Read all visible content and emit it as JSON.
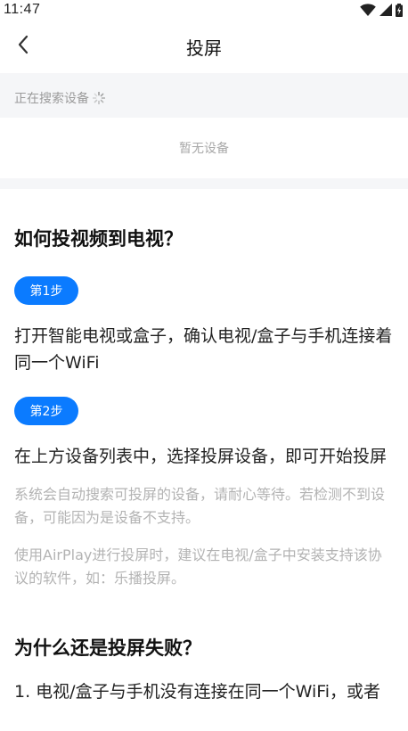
{
  "status_bar": {
    "time": "11:47",
    "icons": [
      "wifi-icon",
      "cell-signal-icon",
      "battery-charging-icon"
    ]
  },
  "header": {
    "title": "投屏",
    "back_icon": "chevron-left-icon"
  },
  "device_search": {
    "status_text": "正在搜索设备",
    "spinner_icon": "loading-spinner-icon",
    "empty_text": "暂无设备"
  },
  "help": {
    "title": "如何投视频到电视？",
    "steps": [
      {
        "badge": "第1步",
        "text": "打开智能电视或盒子，确认电视/盒子与手机连接着同一个WiFi"
      },
      {
        "badge": "第2步",
        "text": "在上方设备列表中，选择投屏设备，即可开始投屏"
      }
    ],
    "notes": [
      "系统会自动搜索可投屏的设备，请耐心等待。若检测不到设备，可能因为是设备不支持。",
      "使用AirPlay进行投屏时，建议在电视/盒子中安装支持该协议的软件，如：乐播投屏。"
    ]
  },
  "failure": {
    "title": "为什么还是投屏失败？",
    "items": [
      "1. 电视/盒子与手机没有连接在同一个WiFi，或者"
    ]
  },
  "colors": {
    "accent": "#0b7bff",
    "section_background": "#f5f6f8",
    "muted_text": "#b3b3b3",
    "body_text": "#222222"
  }
}
